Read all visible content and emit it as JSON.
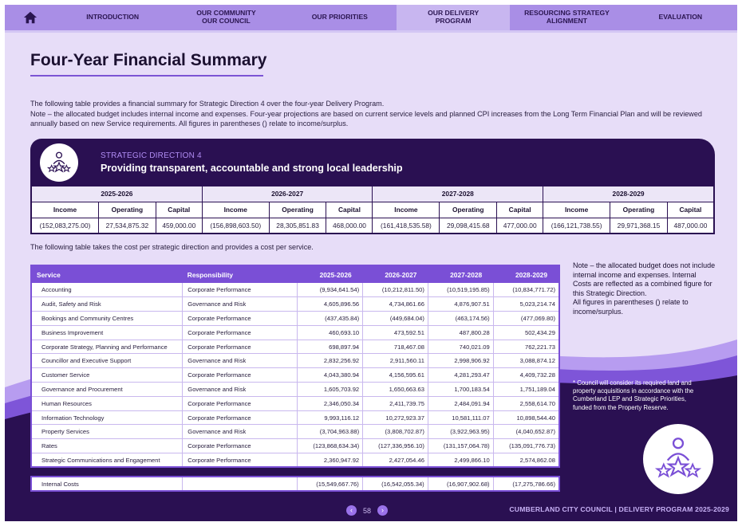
{
  "nav": {
    "tabs": [
      {
        "label": "INTRODUCTION",
        "active": false
      },
      {
        "label": "OUR COMMUNITY\nOUR COUNCIL",
        "active": false
      },
      {
        "label": "OUR PRIORITIES",
        "active": false
      },
      {
        "label": "OUR DELIVERY\nPROGRAM",
        "active": true
      },
      {
        "label": "RESOURCING STRATEGY\nALIGNMENT",
        "active": false
      },
      {
        "label": "EVALUATION",
        "active": false
      }
    ]
  },
  "page_title": "Four-Year Financial Summary",
  "intro_lines": [
    "The following table provides a financial summary for Strategic Direction 4 over the four-year Delivery Program.",
    "Note – the allocated budget includes internal income and expenses. Four-year projections are based on current service levels and planned CPI increases from the Long Term Financial Plan and will be reviewed annually based on new Service requirements. All figures in parentheses () relate to income/surplus."
  ],
  "strategic_direction": {
    "kicker": "STRATEGIC DIRECTION 4",
    "title": "Providing transparent, accountable and strong local leadership"
  },
  "financial_summary": {
    "years": [
      "2025-2026",
      "2026-2027",
      "2027-2028",
      "2028-2029"
    ],
    "subcolumns": [
      "Income",
      "Operating",
      "Capital"
    ],
    "values": [
      [
        "(152,083,275.00)",
        "27,534,875.32",
        "459,000.00"
      ],
      [
        "(156,898,603.50)",
        "28,305,851.83",
        "468,000.00"
      ],
      [
        "(161,418,535.58)",
        "29,098,415.68",
        "477,000.00"
      ],
      [
        "(166,121,738.55)",
        "29,971,368.15",
        "487,000.00"
      ]
    ]
  },
  "cost_intro": "The following table takes the cost per strategic direction and provides a cost per service.",
  "service_table": {
    "headers": [
      "Service",
      "Responsibility",
      "2025-2026",
      "2026-2027",
      "2027-2028",
      "2028-2029"
    ],
    "rows": [
      [
        "Accounting",
        "Corporate Performance",
        "(9,934,641.54)",
        "(10,212,811.50)",
        "(10,519,195.85)",
        "(10,834,771.72)"
      ],
      [
        "Audit, Safety and Risk",
        "Governance and Risk",
        "4,605,896.56",
        "4,734,861.66",
        "4,876,907.51",
        "5,023,214.74"
      ],
      [
        "Bookings and Community Centres",
        "Corporate Performance",
        "(437,435.84)",
        "(449,684.04)",
        "(463,174.56)",
        "(477,069.80)"
      ],
      [
        "Business Improvement",
        "Corporate Performance",
        "460,693.10",
        "473,592.51",
        "487,800.28",
        "502,434.29"
      ],
      [
        "Corporate Strategy, Planning and Performance",
        "Corporate Performance",
        "698,897.94",
        "718,467.08",
        "740,021.09",
        "762,221.73"
      ],
      [
        "Councillor and Executive Support",
        "Governance and Risk",
        "2,832,256.92",
        "2,911,560.11",
        "2,998,906.92",
        "3,088,874.12"
      ],
      [
        "Customer Service",
        "Corporate Performance",
        "4,043,380.94",
        "4,156,595.61",
        "4,281,293.47",
        "4,409,732.28"
      ],
      [
        "Governance and Procurement",
        "Governance and Risk",
        "1,605,703.92",
        "1,650,663.63",
        "1,700,183.54",
        "1,751,189.04"
      ],
      [
        "Human Resources",
        "Corporate Performance",
        "2,346,050.34",
        "2,411,739.75",
        "2,484,091.94",
        "2,558,614.70"
      ],
      [
        "Information Technology",
        "Corporate Performance",
        "9,993,116.12",
        "10,272,923.37",
        "10,581,111.07",
        "10,898,544.40"
      ],
      [
        "Property Services",
        "Governance and Risk",
        "(3,704,963.88)",
        "(3,808,702.87)",
        "(3,922,963.95)",
        "(4,040,652.87)"
      ],
      [
        "Rates",
        "Corporate Performance",
        "(123,868,634.34)",
        "(127,336,956.10)",
        "(131,157,064.78)",
        "(135,091,776.73)"
      ],
      [
        "Strategic Communications and Engagement",
        "Corporate Performance",
        "2,360,947.92",
        "2,427,054.46",
        "2,499,866.10",
        "2,574,862.08"
      ]
    ],
    "internal_costs": [
      "Internal Costs",
      "",
      "(15,549,667.76)",
      "(16,542,055.34)",
      "(16,907,902.68)",
      "(17,275,786.66)"
    ]
  },
  "side_note_1": "Note – the allocated budget does not include internal income and expenses. Internal Costs are reflected as a combined figure for this Strategic Direction.\nAll figures in parentheses () relate to income/surplus.",
  "side_note_2": "* Council will consider its required land and property acquisitions in accordance with the Cumberland LEP and Strategic Priorities, funded from the Property Reserve.",
  "pager": {
    "page": "58",
    "prev": "‹",
    "next": "›"
  },
  "footer": "CUMBERLAND CITY COUNCIL | DELIVERY PROGRAM 2025-2029",
  "colors": {
    "nav": "#a98ee6",
    "page_bg": "#e7ddf8",
    "dark": "#2a1052",
    "accent": "#7a4fd6"
  }
}
